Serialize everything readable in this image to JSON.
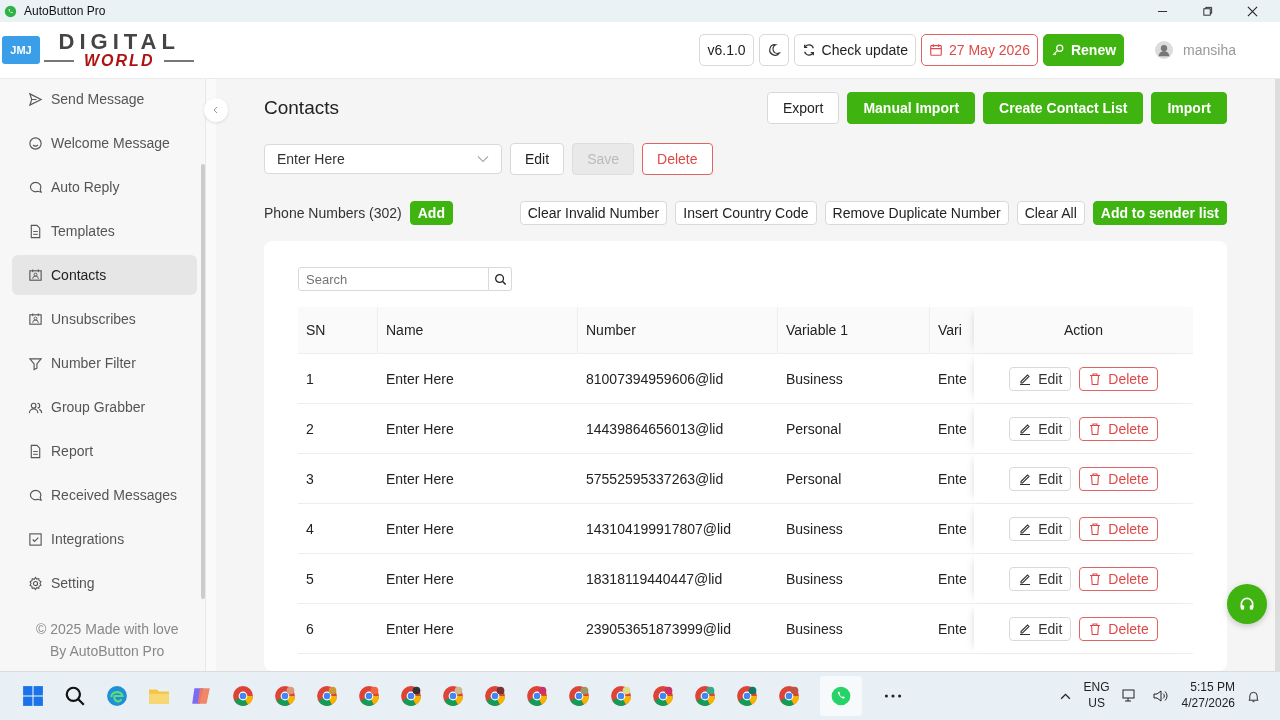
{
  "window": {
    "title": "AutoButton Pro"
  },
  "logo": {
    "badge": "JMJ",
    "line1": "DIGITAL",
    "line2": "WORLD"
  },
  "header": {
    "version": "v6.1.0",
    "check_update": "Check update",
    "expiry": "27 May 2026",
    "renew": "Renew",
    "user": "mansiha"
  },
  "sidebar": {
    "items": [
      {
        "label": "Send Message",
        "selected": false
      },
      {
        "label": "Welcome Message",
        "selected": false
      },
      {
        "label": "Auto Reply",
        "selected": false
      },
      {
        "label": "Templates",
        "selected": false
      },
      {
        "label": "Contacts",
        "selected": true
      },
      {
        "label": "Unsubscribes",
        "selected": false
      },
      {
        "label": "Number Filter",
        "selected": false
      },
      {
        "label": "Group Grabber",
        "selected": false
      },
      {
        "label": "Report",
        "selected": false
      },
      {
        "label": "Received Messages",
        "selected": false
      },
      {
        "label": "Integrations",
        "selected": false
      },
      {
        "label": "Setting",
        "selected": false
      }
    ],
    "footer": [
      "© 2025 Made with love",
      "By AutoButton Pro"
    ]
  },
  "page": {
    "title": "Contacts",
    "actions": [
      {
        "label": "Export",
        "kind": "outline"
      },
      {
        "label": "Manual Import",
        "kind": "primary"
      },
      {
        "label": "Create Contact List",
        "kind": "primary"
      },
      {
        "label": "Import",
        "kind": "primary"
      }
    ]
  },
  "list_select": {
    "placeholder": "Enter Here",
    "buttons": [
      {
        "label": "Edit",
        "kind": "outline",
        "disabled": false
      },
      {
        "label": "Save",
        "kind": "outline",
        "disabled": true
      },
      {
        "label": "Delete",
        "kind": "danger",
        "disabled": false
      }
    ]
  },
  "phone_numbers": {
    "label": "Phone Numbers (302)",
    "add": "Add",
    "tools": [
      {
        "label": "Clear Invalid Number",
        "kind": "outline"
      },
      {
        "label": "Insert Country Code",
        "kind": "outline"
      },
      {
        "label": "Remove Duplicate Number",
        "kind": "outline"
      },
      {
        "label": "Clear All",
        "kind": "outline"
      },
      {
        "label": "Add to sender list",
        "kind": "primary"
      }
    ]
  },
  "table": {
    "search_placeholder": "Search",
    "columns": [
      "SN",
      "Name",
      "Number",
      "Variable 1",
      "Vari",
      "Action"
    ],
    "rows": [
      {
        "sn": "1",
        "name": "Enter Here",
        "number": "81007394959606@lid",
        "variable_1": "Business",
        "column_5": "Ente",
        "edit": "Edit",
        "delete": "Delete"
      },
      {
        "sn": "2",
        "name": "Enter Here",
        "number": "14439864656013@lid",
        "variable_1": "Personal",
        "column_5": "Ente",
        "edit": "Edit",
        "delete": "Delete"
      },
      {
        "sn": "3",
        "name": "Enter Here",
        "number": "57552595337263@lid",
        "variable_1": "Personal",
        "column_5": "Ente",
        "edit": "Edit",
        "delete": "Delete"
      },
      {
        "sn": "4",
        "name": "Enter Here",
        "number": "143104199917807@lid",
        "variable_1": "Business",
        "column_5": "Ente",
        "edit": "Edit",
        "delete": "Delete"
      },
      {
        "sn": "5",
        "name": "Enter Here",
        "number": "18318119440447@lid",
        "variable_1": "Business",
        "column_5": "Ente",
        "edit": "Edit",
        "delete": "Delete"
      },
      {
        "sn": "6",
        "name": "Enter Here",
        "number": "239053651873999@lid",
        "variable_1": "Business",
        "column_5": "Ente",
        "edit": "Edit",
        "delete": "Delete"
      }
    ]
  },
  "taskbar": {
    "language": "ENG",
    "region": "US",
    "time": "5:15 PM",
    "date": "4/27/2026"
  }
}
